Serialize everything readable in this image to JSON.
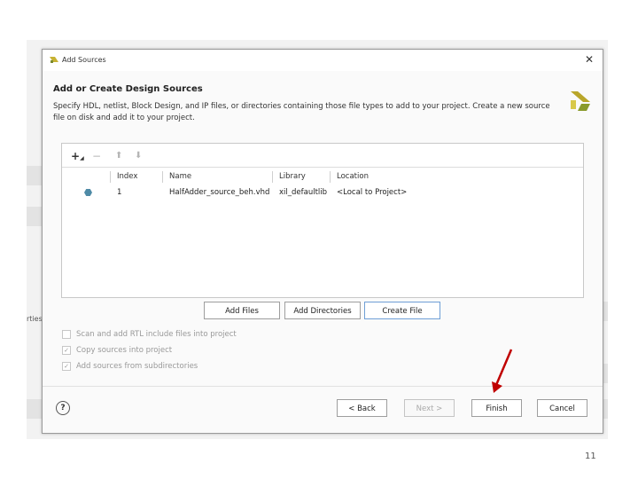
{
  "dialog": {
    "title": "Add Sources",
    "close_glyph": "✕",
    "header_title": "Add or Create Design Sources",
    "header_description": "Specify HDL, netlist, Block Design, and IP files, or directories containing those file types to add to your project. Create a new source file on disk and add it to your project.",
    "logo_icon": "vivado-logo-icon"
  },
  "toolbar": {
    "add_glyph": "+",
    "remove_glyph": "−",
    "up_glyph": "⬆",
    "down_glyph": "⬇"
  },
  "table": {
    "headers": [
      "Index",
      "Name",
      "Library",
      "Location"
    ],
    "rows": [
      {
        "index": "1",
        "name": "HalfAdder_source_beh.vhd",
        "library": "xil_defaultlib",
        "location": "<Local to Project>"
      }
    ]
  },
  "file_buttons": {
    "add_files": "Add Files",
    "add_directories": "Add Directories",
    "create_file": "Create File"
  },
  "options": [
    {
      "label": "Scan and add RTL include files into project",
      "checked": false
    },
    {
      "label": "Copy sources into project",
      "checked": true
    },
    {
      "label": "Add sources from subdirectories",
      "checked": true
    }
  ],
  "footer": {
    "help_glyph": "?",
    "back": "< Back",
    "next": "Next >",
    "finish": "Finish",
    "cancel": "Cancel"
  },
  "background": {
    "side_label": "rties"
  },
  "slide": {
    "page_number": "11",
    "arrow_color": "#c00000"
  }
}
